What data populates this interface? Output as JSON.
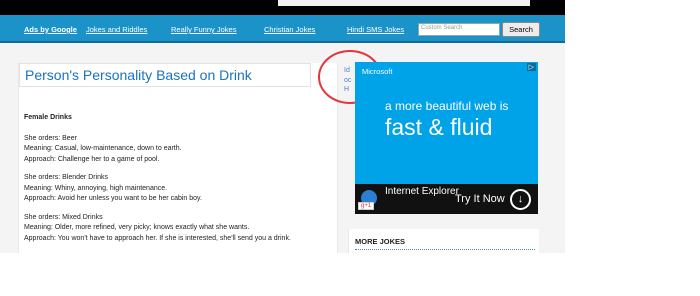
{
  "nav": {
    "items": [
      "Ads by Google",
      "Jokes and Riddles",
      "Really Funny Jokes",
      "Christian Jokes",
      "Hindi SMS Jokes"
    ],
    "search_placeholder": "Custom Search",
    "search_button": "Search"
  },
  "article": {
    "title": "Person's Personality Based on Drink",
    "section_heading": "Female Drinks",
    "entries": [
      {
        "order": "She orders: Beer",
        "meaning": "Meaning: Casual, low-maintenance, down to earth.",
        "approach": "Approach: Challenge her to a game of pool."
      },
      {
        "order": "She orders: Blender Drinks",
        "meaning": "Meaning: Whiny, annoying, high maintenance.",
        "approach": "Approach: Avoid her unless you want to be her cabin boy."
      },
      {
        "order": "She orders: Mixed Drinks",
        "meaning": "Meaning: Older, more refined, very picky; knows exactly what she wants.",
        "approach": "Approach: You won't have to approach her. If she is interested, she'll send you a drink."
      }
    ]
  },
  "side_links": [
    "Id",
    "oc",
    "H"
  ],
  "ad": {
    "brand": "Microsoft",
    "line1": "a more beautiful web is",
    "line2": "fast & fluid",
    "product": "Internet Explorer",
    "cta": "Try It Now"
  },
  "sidebar": {
    "more_jokes": "MORE JOKES"
  }
}
